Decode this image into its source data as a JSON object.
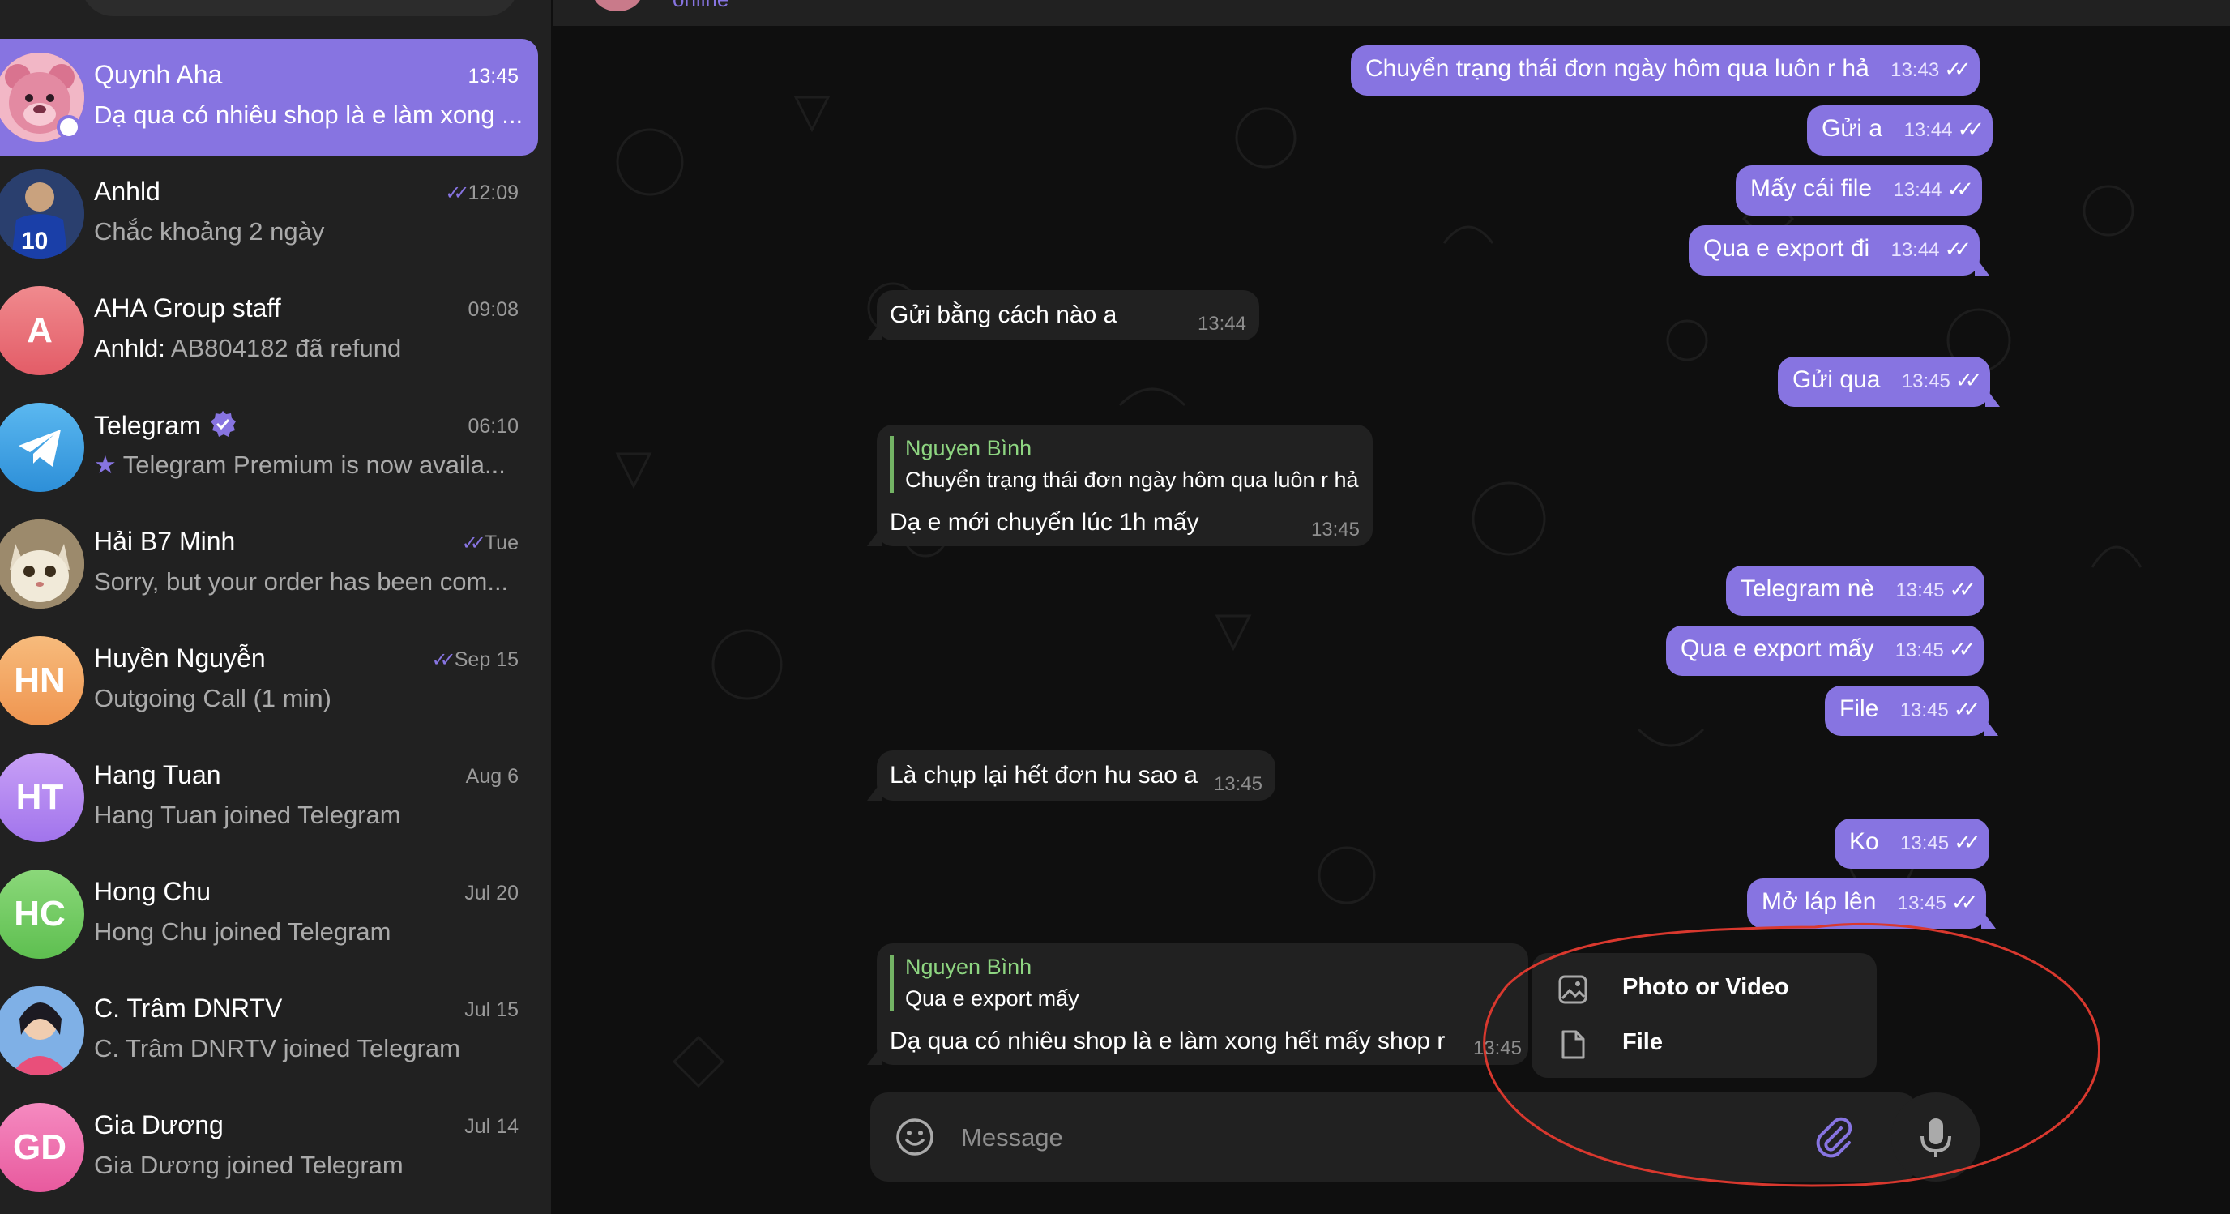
{
  "sidebar": {
    "chats": [
      {
        "name": "Quynh Aha",
        "preview": "Dạ qua có nhiêu shop là e làm xong ...",
        "time": "13:45",
        "active": true,
        "avatar_color": "#e88fa6"
      },
      {
        "name": "Anhld",
        "preview": "Chắc khoảng 2 ngày",
        "time": "12:09",
        "read": true,
        "avatar_color": "#1d3a7a"
      },
      {
        "name": "AHA Group staff",
        "sender": "Anhld",
        "preview": "AB804182 đã refund",
        "time": "09:08",
        "initials": "A",
        "avatar_color": "#ec7279"
      },
      {
        "name": "Telegram",
        "preview": "Telegram Premium is now availa...",
        "time": "06:10",
        "verified": true,
        "avatar_color": "#3ba4e6"
      },
      {
        "name": "Hải B7 Minh",
        "preview": "Sorry, but your order has been com...",
        "time": "Tue",
        "read": true,
        "avatar_color": "#b89a6a"
      },
      {
        "name": "Huyền Nguyễn",
        "preview": "Outgoing Call (1 min)",
        "time": "Sep 15",
        "read": true,
        "initials": "HN",
        "avatar_color": "#f3a460"
      },
      {
        "name": "Hang Tuan",
        "preview": "Hang Tuan joined Telegram",
        "time": "Aug 6",
        "initials": "HT",
        "avatar_color": "#b387f0"
      },
      {
        "name": "Hong Chu",
        "preview": "Hong Chu joined Telegram",
        "time": "Jul 20",
        "initials": "HC",
        "avatar_color": "#74cb65"
      },
      {
        "name": "C. Trâm DNRTV",
        "preview": "C. Trâm DNRTV joined Telegram",
        "time": "Jul 15",
        "avatar_color": "#5a8ed0"
      },
      {
        "name": "Gia Dương",
        "preview": "Gia Dương joined Telegram",
        "time": "Jul 14",
        "initials": "GD",
        "avatar_color": "#ee6fae"
      }
    ]
  },
  "header": {
    "status": "online"
  },
  "messages": [
    {
      "dir": "out",
      "text": "Chuyển trạng thái đơn ngày hôm qua luôn r hả",
      "time": "13:43"
    },
    {
      "dir": "out",
      "text": "Gửi a",
      "time": "13:44"
    },
    {
      "dir": "out",
      "text": "Mấy cái file",
      "time": "13:44"
    },
    {
      "dir": "out",
      "text": "Qua e export đi",
      "time": "13:44"
    },
    {
      "dir": "in",
      "text": "Gửi bằng cách nào a",
      "time": "13:44"
    },
    {
      "dir": "out",
      "text": "Gửi qua",
      "time": "13:45"
    },
    {
      "dir": "in",
      "reply_name": "Nguyen Bình",
      "reply_text": "Chuyển trạng thái đơn ngày hôm qua luôn r hả",
      "text": "Dạ e mới chuyển lúc 1h mấy",
      "time": "13:45"
    },
    {
      "dir": "out",
      "text": "Telegram nè",
      "time": "13:45"
    },
    {
      "dir": "out",
      "text": "Qua e export mấy",
      "time": "13:45"
    },
    {
      "dir": "out",
      "text": "File",
      "time": "13:45"
    },
    {
      "dir": "in",
      "text": "Là chụp lại hết đơn hu sao a",
      "time": "13:45"
    },
    {
      "dir": "out",
      "text": "Ko",
      "time": "13:45"
    },
    {
      "dir": "out",
      "text": "Mở láp lên",
      "time": "13:45"
    },
    {
      "dir": "in",
      "reply_name": "Nguyen Bình",
      "reply_text": "Qua e export mấy",
      "text": "Dạ qua có nhiêu shop là e làm xong hết mấy shop r",
      "time": "13:45"
    }
  ],
  "composer": {
    "placeholder": "Message"
  },
  "attach_menu": {
    "items": [
      "Photo or Video",
      "File"
    ]
  },
  "colors": {
    "accent": "#8774e1",
    "incoming_bubble": "#212121",
    "background": "#0f0f0f",
    "annotation": "#d9382e"
  }
}
